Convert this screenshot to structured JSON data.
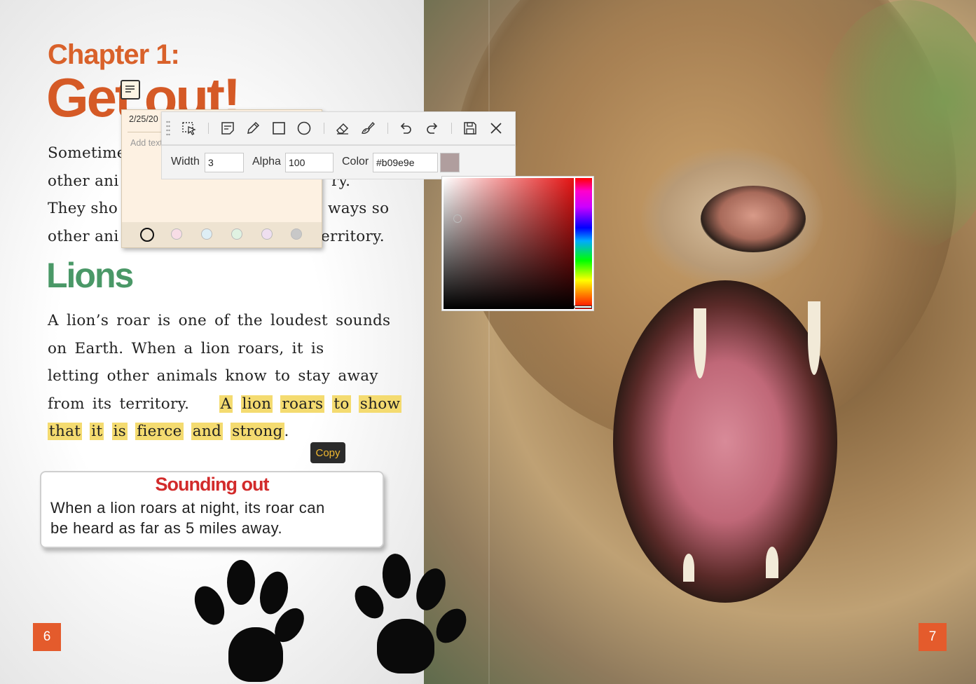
{
  "left_page": {
    "chapter_title": "Chapter 1:",
    "chapter_subtitle": "Get out!",
    "intro_lines": [
      "Sometime",
      "other ani",
      "They sho",
      "other ani"
    ],
    "intro_line_ends": [
      "",
      "ry.",
      "ways so",
      "erritory."
    ],
    "lions_heading": "Lions",
    "para_lines": [
      "A lion’s roar is one of the loudest sounds",
      "on Earth.  When a lion roars, it is",
      "letting other animals know to stay away",
      "from its territory."
    ],
    "highlight_words": [
      "A",
      "lion",
      "roars",
      "to",
      "show",
      "that",
      "it",
      "is",
      "fierce",
      "and",
      "strong"
    ],
    "period": ".",
    "sounding_out_title": "Sounding out",
    "sounding_out_lines": [
      "When a lion roars at night, its roar can",
      "be heard as far as 5 miles away."
    ],
    "page_number": "6"
  },
  "right_page": {
    "page_number": "7"
  },
  "copy_button": "Copy",
  "note": {
    "date": "2/25/20",
    "placeholder": "Add text...",
    "colors": [
      "#fdf1e2",
      "#f8dde6",
      "#deeef5",
      "#e0f2e2",
      "#efdff0",
      "#c8c8c8"
    ]
  },
  "toolbar": {
    "tools": [
      "select-icon",
      "note-icon",
      "pencil-icon",
      "rectangle-icon",
      "circle-icon",
      "eraser-icon",
      "brush-icon",
      "undo-icon",
      "redo-icon",
      "save-icon",
      "close-icon"
    ]
  },
  "props": {
    "width_label": "Width",
    "width_value": "3",
    "alpha_label": "Alpha",
    "alpha_value": "100",
    "color_label": "Color",
    "color_value": "#b09e9e",
    "swatch_color": "#b09e9e"
  },
  "colors": {
    "accent_orange": "#e45b2c",
    "heading_green": "#4a9867",
    "highlight": "#f4db70"
  }
}
